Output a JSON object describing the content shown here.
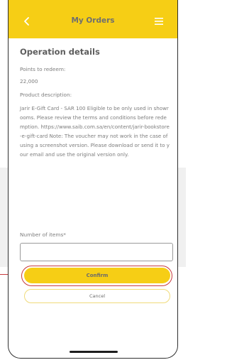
{
  "header": {
    "title": "My Orders",
    "back_icon": "chevron-left-icon",
    "menu_icon": "hamburger-menu-icon"
  },
  "section": {
    "title": "Operation details"
  },
  "details": {
    "points_label": "Points to redeem:",
    "points_value": "22,000",
    "product_label": "Product description:",
    "product_description": "Jarir E-Gift Card - SAR 100 Eligible to be only used in showrooms. Please review the terms and conditions before redemption. https://www.saib.com.sa/en/content/jarir-bookstore-e-gift-card Note: The voucher may not work in the case of using a screenshot version. Please download or send it to your email and use the original version only."
  },
  "form": {
    "items_label": "Number of items*",
    "items_value": ""
  },
  "actions": {
    "confirm_label": "Confirm",
    "cancel_label": "Cancel"
  },
  "colors": {
    "accent": "#f6ce15",
    "highlight": "#c83b3e"
  }
}
